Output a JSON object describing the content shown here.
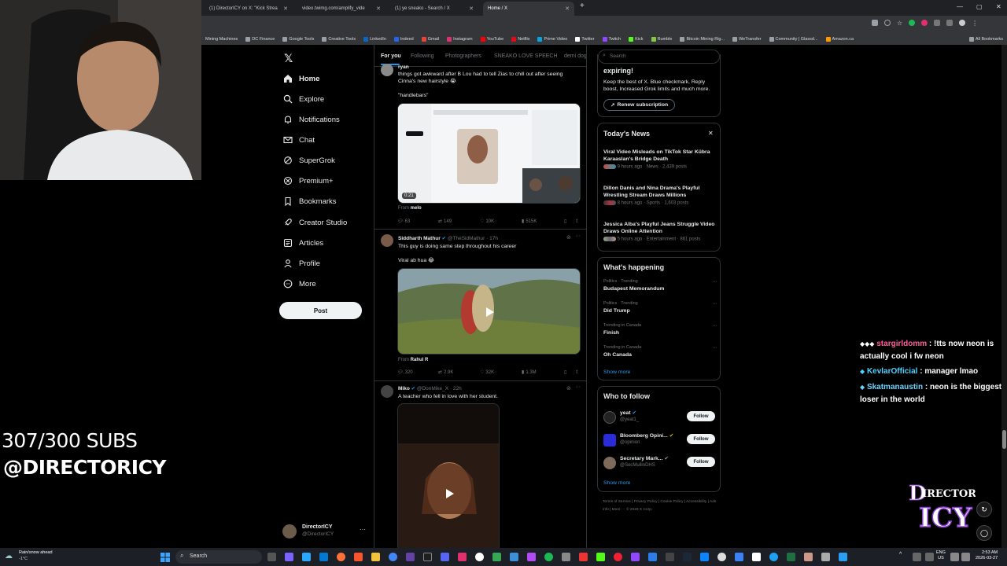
{
  "browser": {
    "tabs": [
      {
        "title": "(1) DirectorICY on X: \"Kick Strea"
      },
      {
        "title": "video.twimg.com/amplify_vide"
      },
      {
        "title": "(1) ye sneako - Search / X"
      },
      {
        "title": "Home / X"
      }
    ],
    "bookmarks": [
      "Mining Machines",
      "DC Finance",
      "Google Tools",
      "Creative Tools",
      "LinkedIn",
      "Indeed",
      "Gmail",
      "Instagram",
      "YouTube",
      "Netflix",
      "Prime Video",
      "Twitter",
      "Twitch",
      "Kick",
      "Rumble",
      "Bitcoin Mining Rig...",
      "WeTransfer",
      "Community | Glassd...",
      "Amazon.ca",
      "All Bookmarks"
    ]
  },
  "nav": {
    "items": [
      "Home",
      "Explore",
      "Notifications",
      "Chat",
      "SuperGrok",
      "Premium+",
      "Bookmarks",
      "Creator Studio",
      "Articles",
      "Profile",
      "More"
    ],
    "post_label": "Post",
    "account_name": "DirectorICY",
    "account_handle": "@DirectorICY"
  },
  "feed": {
    "tabs": [
      "For you",
      "Following",
      "Photographers",
      "SNEAKO LOVE SPEECH",
      "demi dog"
    ],
    "tweet1": {
      "name": "ryan",
      "line1": "things got awkward after B Lou had to tell Zias to chill out after seeing",
      "line2": "Cinna's new hairstyle 😭",
      "quote": "\"handlebars\"",
      "duration": "0:21",
      "from_label": "From",
      "from": "melo",
      "replies": "63",
      "reposts": "149",
      "likes": "10K",
      "views": "515K"
    },
    "tweet2": {
      "name": "Siddharth Mathur",
      "handle": "@TheSidMathur · 17h",
      "text": "This guy is doing same step throughout his career",
      "sub": "Viral ab hua 😂",
      "from_label": "From",
      "from": "Rahul R",
      "replies": "320",
      "reposts": "2.9K",
      "likes": "32K",
      "views": "1.3M"
    },
    "tweet3": {
      "name": "Miko",
      "handle": "@DonMike_X · 22h",
      "text": "A teacher who fell in love with her student."
    }
  },
  "sidebar": {
    "search_placeholder": "Search",
    "premium": {
      "title": "expiring!",
      "text": "Keep the best of X. Blue checkmark, Reply boost, Increased Grok limits and much more.",
      "button": "Renew subscription"
    },
    "news": {
      "title": "Today's News",
      "items": [
        {
          "title": "Viral Video Misleads on TikTok Star Kübra Karaaslan's Bridge Death",
          "meta": "9 hours ago · News · 2,439 posts"
        },
        {
          "title": "Dillon Danis and Nina Drama's Playful Wrestling Stream Draws Millions",
          "meta": "8 hours ago · Sports · 1,603 posts"
        },
        {
          "title": "Jessica Alba's Playful Jeans Struggle Video Draws Online Attention",
          "meta": "5 hours ago · Entertainment · 861 posts"
        }
      ]
    },
    "happening": {
      "title": "What's happening",
      "items": [
        {
          "context": "Politics · Trending",
          "topic": "Budapest Memorandum"
        },
        {
          "context": "Politics · Trending",
          "topic": "Did Trump"
        },
        {
          "context": "Trending in Canada",
          "topic": "Finish"
        },
        {
          "context": "Trending in Canada",
          "topic": "Oh Canada"
        }
      ],
      "show_more": "Show more"
    },
    "follow": {
      "title": "Who to follow",
      "items": [
        {
          "name": "yeat",
          "handle": "@yeat1_"
        },
        {
          "name": "Bloomberg Opini...",
          "handle": "@opinion"
        },
        {
          "name": "Secretary Mark...",
          "handle": "@SecMullinDHS"
        }
      ],
      "button": "Follow",
      "show_more": "Show more"
    },
    "footer": [
      "Terms of Service",
      "Privacy Policy",
      "Cookie Policy",
      "Accessibility",
      "Ads info",
      "More ···",
      "© 2026 X Corp."
    ]
  },
  "overlay": {
    "subs": "307/300 SUBS",
    "handle": "@DIRECTORICY",
    "logo_text": "DirectorICY",
    "chat": [
      {
        "user": "stargirldomm",
        "user_color": "#ff5f9e",
        "message": "!tts now neon is actually cool i fw neon"
      },
      {
        "user": "KevlarOfficial",
        "user_color": "#4fd1ff",
        "message": "manager lmao"
      },
      {
        "user": "Skatmanaustin",
        "user_color": "#6ad4ff",
        "message": "neon is the biggest loser in the world"
      }
    ]
  },
  "taskbar": {
    "weather": "Rain/snow ahead",
    "temp": "-1°C",
    "search": "Search",
    "lang": "ENG",
    "region": "US",
    "time": "2:53 AM",
    "date": "2026-03-27"
  }
}
